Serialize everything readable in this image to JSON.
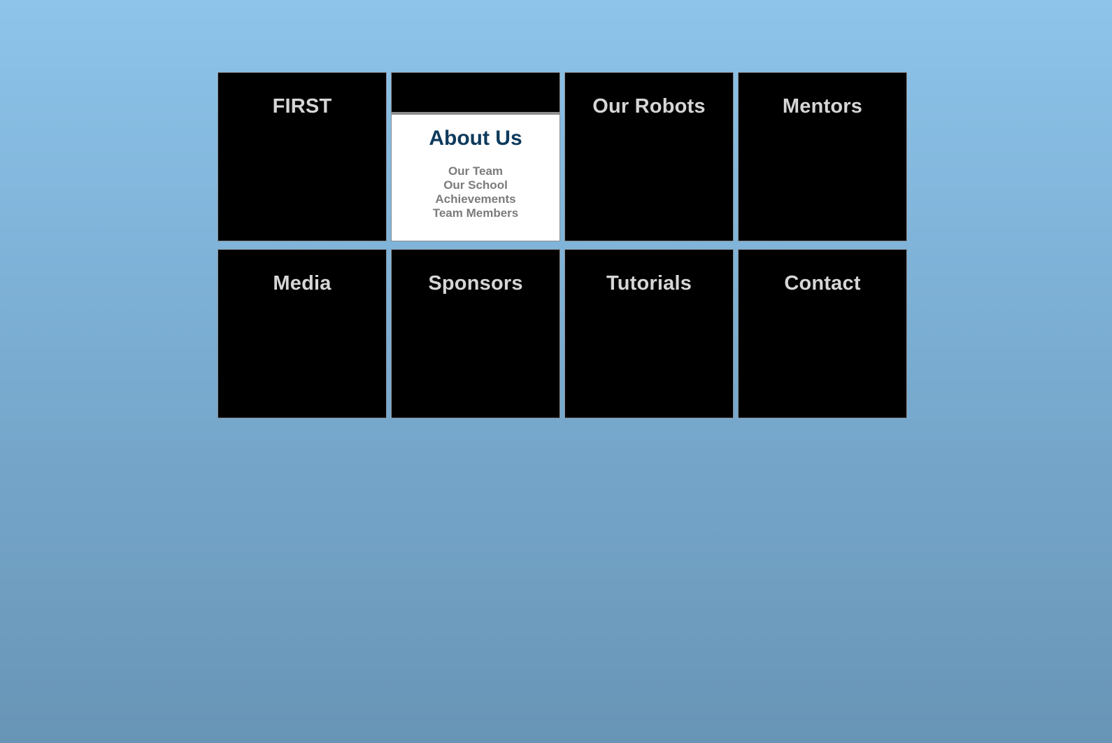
{
  "nav": {
    "tiles": [
      {
        "label": "FIRST"
      },
      {
        "label": "About Us"
      },
      {
        "label": "Our Robots"
      },
      {
        "label": "Mentors"
      },
      {
        "label": "Media"
      },
      {
        "label": "Sponsors"
      },
      {
        "label": "Tutorials"
      },
      {
        "label": "Contact"
      }
    ],
    "about_submenu": [
      "Our Team",
      "Our School",
      "Achievements",
      "Team Members"
    ]
  },
  "colors": {
    "background_top": "#8ec4ea",
    "background_bottom": "#6895b6",
    "tile_background": "#000000",
    "tile_text": "#d6d6d6",
    "active_title": "#0e3a5c",
    "submenu_text": "#7b7b7b"
  }
}
